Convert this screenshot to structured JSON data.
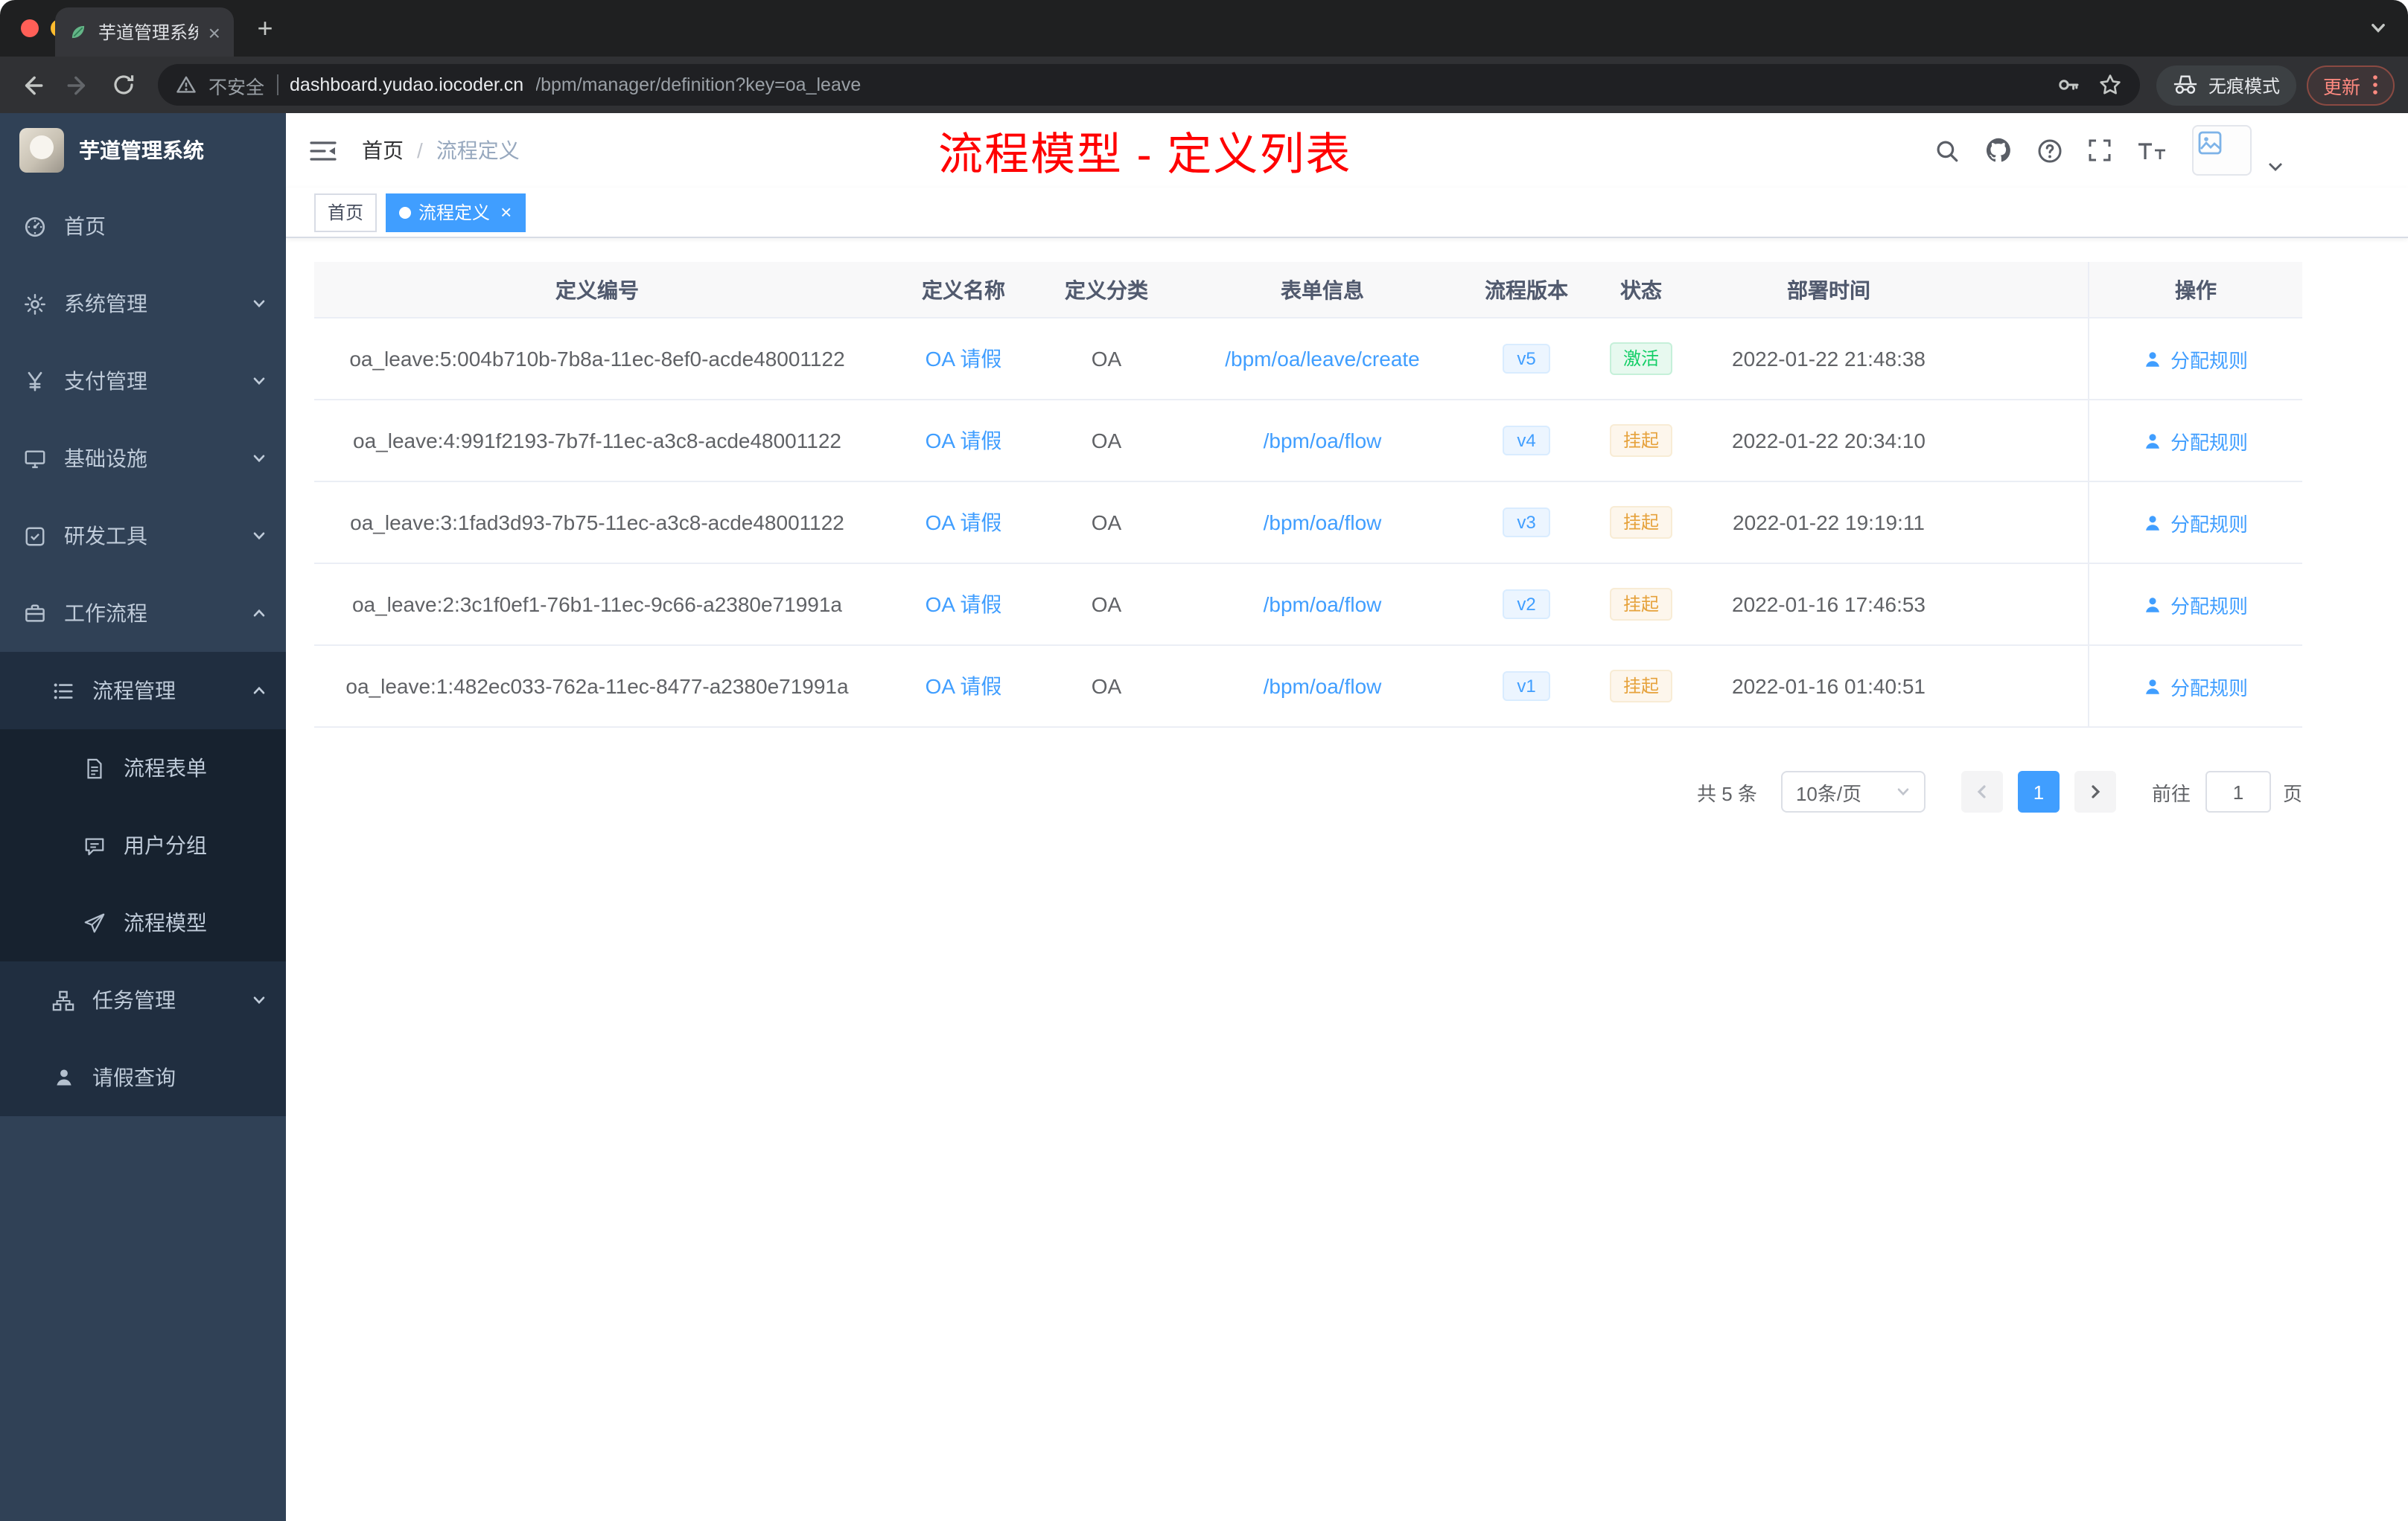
{
  "colors": {
    "accent_blue": "#409eff",
    "success_green": "#13ce66",
    "warning_orange": "#e6a23c",
    "annotation_red": "#ff0000",
    "sidebar_bg": "#304156"
  },
  "browser": {
    "tab_title": "芋道管理系统",
    "security_label": "不安全",
    "url_host": "dashboard.yudao.iocoder.cn",
    "url_path": "/bpm/manager/definition?key=oa_leave",
    "incognito_label": "无痕模式",
    "update_label": "更新"
  },
  "sidebar": {
    "logo_title": "芋道管理系统",
    "items": [
      {
        "label": "首页"
      },
      {
        "label": "系统管理"
      },
      {
        "label": "支付管理"
      },
      {
        "label": "基础设施"
      },
      {
        "label": "研发工具"
      },
      {
        "label": "工作流程"
      },
      {
        "label": "流程管理"
      },
      {
        "label": "流程表单"
      },
      {
        "label": "用户分组"
      },
      {
        "label": "流程模型"
      },
      {
        "label": "任务管理"
      },
      {
        "label": "请假查询"
      }
    ]
  },
  "header": {
    "breadcrumb_home": "首页",
    "breadcrumb_separator": "/",
    "breadcrumb_current": "流程定义",
    "annotation": "流程模型 - 定义列表"
  },
  "tags": [
    {
      "label": "首页"
    },
    {
      "label": "流程定义"
    }
  ],
  "table": {
    "columns": [
      "定义编号",
      "定义名称",
      "定义分类",
      "表单信息",
      "流程版本",
      "状态",
      "部署时间",
      "操作"
    ],
    "action_label": "分配规则",
    "rows": [
      {
        "id": "oa_leave:5:004b710b-7b8a-11ec-8ef0-acde48001122",
        "name": "OA 请假",
        "category": "OA",
        "form": "/bpm/oa/leave/create",
        "version": "v5",
        "status": "激活",
        "deployed_at": "2022-01-22 21:48:38"
      },
      {
        "id": "oa_leave:4:991f2193-7b7f-11ec-a3c8-acde48001122",
        "name": "OA 请假",
        "category": "OA",
        "form": "/bpm/oa/flow",
        "version": "v4",
        "status": "挂起",
        "deployed_at": "2022-01-22 20:34:10"
      },
      {
        "id": "oa_leave:3:1fad3d93-7b75-11ec-a3c8-acde48001122",
        "name": "OA 请假",
        "category": "OA",
        "form": "/bpm/oa/flow",
        "version": "v3",
        "status": "挂起",
        "deployed_at": "2022-01-22 19:19:11"
      },
      {
        "id": "oa_leave:2:3c1f0ef1-76b1-11ec-9c66-a2380e71991a",
        "name": "OA 请假",
        "category": "OA",
        "form": "/bpm/oa/flow",
        "version": "v2",
        "status": "挂起",
        "deployed_at": "2022-01-16 17:46:53"
      },
      {
        "id": "oa_leave:1:482ec033-762a-11ec-8477-a2380e71991a",
        "name": "OA 请假",
        "category": "OA",
        "form": "/bpm/oa/flow",
        "version": "v1",
        "status": "挂起",
        "deployed_at": "2022-01-16 01:40:51"
      }
    ]
  },
  "pagination": {
    "total_label": "共 5 条",
    "page_size_label": "10条/页",
    "page": "1",
    "goto_label": "前往",
    "goto_value": "1",
    "page_unit": "页"
  }
}
